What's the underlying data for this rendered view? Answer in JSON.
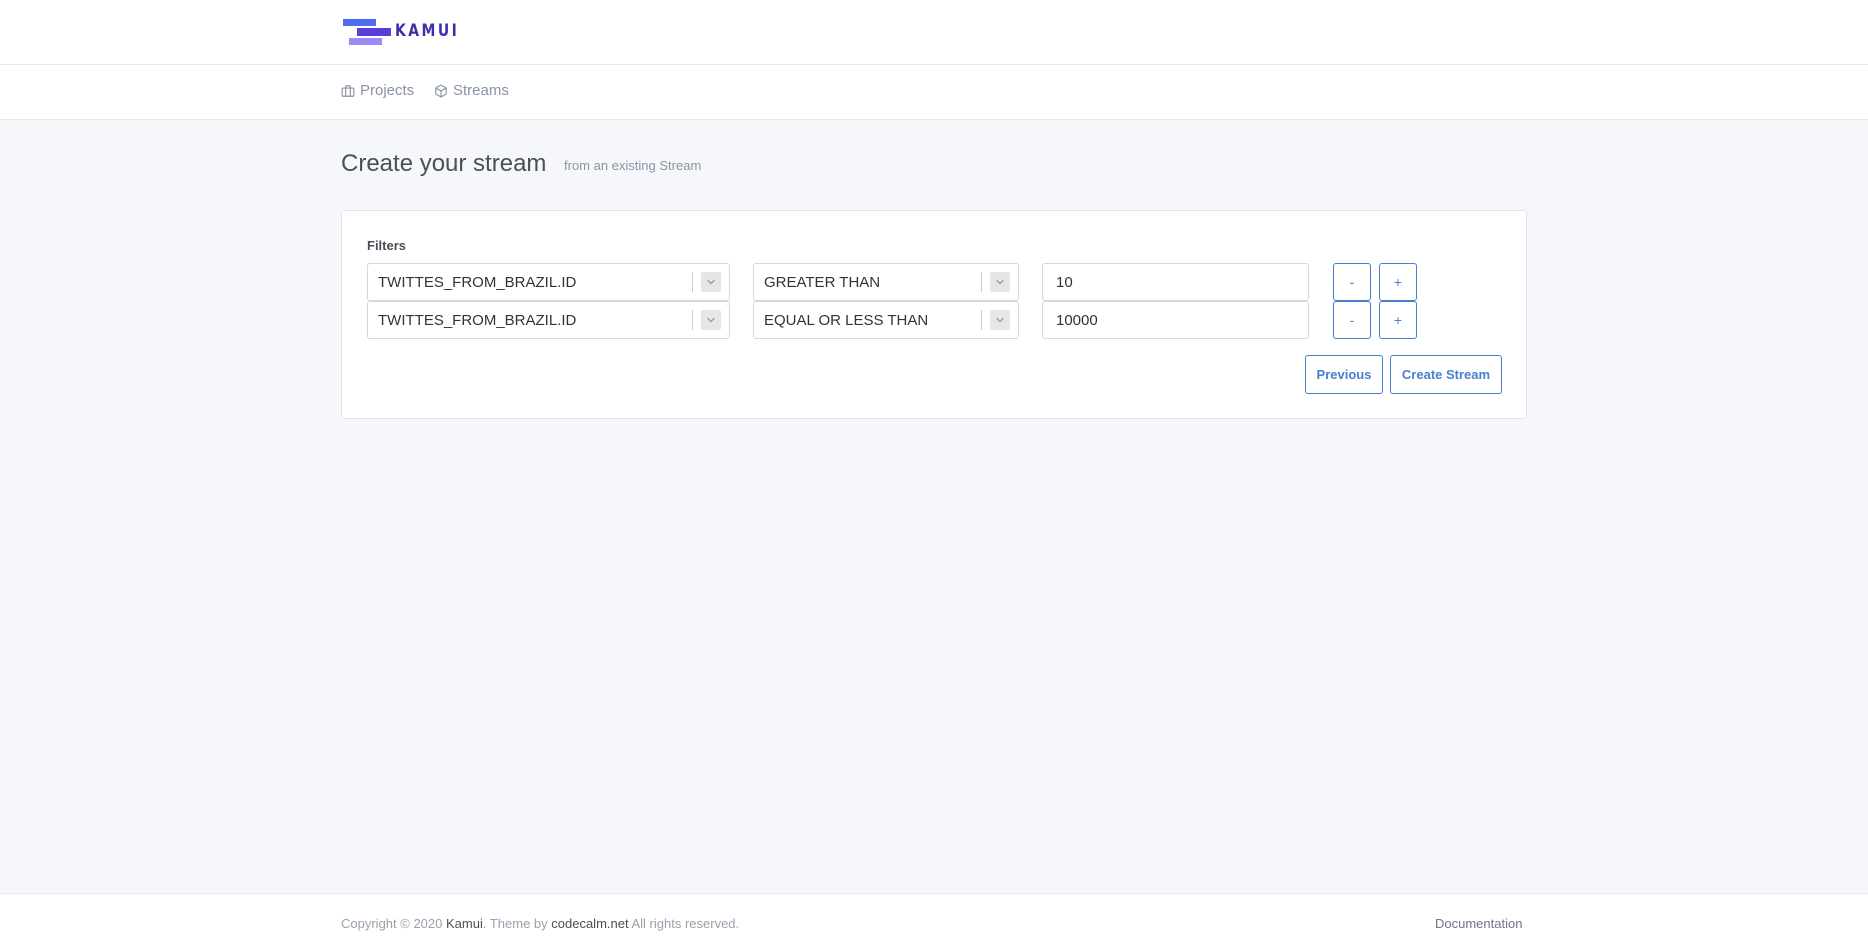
{
  "brand": {
    "name": "KAMUI"
  },
  "nav": {
    "items": [
      {
        "label": "Projects",
        "icon": "briefcase-icon"
      },
      {
        "label": "Streams",
        "icon": "box-icon"
      }
    ]
  },
  "page": {
    "title": "Create your stream",
    "subtitle": "from an existing Stream"
  },
  "filters": {
    "label": "Filters",
    "rows": [
      {
        "field": "TWITTES_FROM_BRAZIL.ID",
        "operator": "GREATER THAN",
        "value": "10",
        "remove_label": "-",
        "add_label": "+"
      },
      {
        "field": "TWITTES_FROM_BRAZIL.ID",
        "operator": "EQUAL OR LESS THAN",
        "value": "10000",
        "remove_label": "-",
        "add_label": "+"
      }
    ]
  },
  "actions": {
    "previous_label": "Previous",
    "create_label": "Create Stream"
  },
  "footer": {
    "copyright": "Copyright © 2020",
    "brand_link": "Kamui",
    "theme_prefix": ". Theme by",
    "theme_link": "codecalm.net",
    "rights": "All rights reserved.",
    "documentation_label": "Documentation"
  },
  "colors": {
    "accent": "#467fcf",
    "background": "#f5f7fb",
    "logo_primary": "#4f6cf0",
    "logo_secondary": "#5a3fd6",
    "logo_tertiary": "#9b8cf5"
  }
}
